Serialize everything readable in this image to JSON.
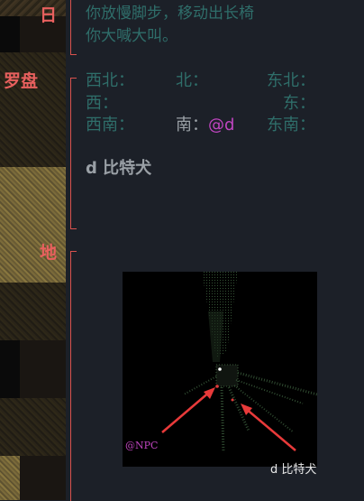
{
  "sections": {
    "sun": "日",
    "compass": "罗盘",
    "map": "地"
  },
  "message": {
    "line1": "你放慢脚步，移动出长椅",
    "line2": "你大喊大叫。"
  },
  "compass": {
    "northwest": "西北：",
    "north": "北：",
    "northeast": "东北：",
    "west": "西：",
    "east": "东：",
    "southwest": "西南：",
    "south": "南：",
    "player_marker": "@d",
    "southeast": "东南："
  },
  "room": {
    "npc_line": "d 比特犬"
  },
  "minimap": {
    "npc_label": "@NPC",
    "caption": "d 比特犬"
  },
  "colors": {
    "section_label": "#e8605e",
    "exits": "#2f6e6a",
    "player": "#c045c0",
    "arrow": "#e83a3a"
  }
}
